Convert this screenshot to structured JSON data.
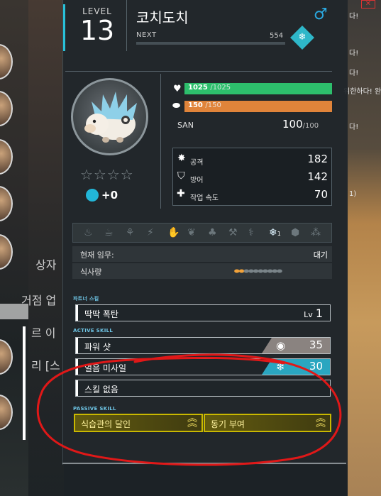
{
  "level": {
    "label": "LEVEL",
    "value": "13"
  },
  "pal": {
    "name": "코치도치",
    "gender_icon": "male-icon",
    "element_icon": "ice-element-icon"
  },
  "next": {
    "label": "NEXT",
    "value": "554",
    "progress_fraction": 0.0
  },
  "stars": {
    "filled": 0,
    "total": 4,
    "glyph": "☆☆☆☆"
  },
  "soul": {
    "value": "+0"
  },
  "hp": {
    "current": "1025",
    "max": "/1025",
    "color": "#2dbe6c"
  },
  "stamina": {
    "current": "150",
    "max": "/150",
    "color": "#e0843a"
  },
  "san": {
    "label": "SAN",
    "value": "100",
    "max": "/100"
  },
  "stats": [
    {
      "label": "공격",
      "value": "182",
      "icon": "attack-icon"
    },
    {
      "label": "방어",
      "value": "142",
      "icon": "shield-icon"
    },
    {
      "label": "작업 속도",
      "value": "70",
      "icon": "work-speed-icon"
    }
  ],
  "work_suitability": {
    "icons": [
      "kindling-icon",
      "watering-icon",
      "planting-icon",
      "electricity-icon",
      "handiwork-icon",
      "gathering-icon",
      "lumbering-icon",
      "mining-icon",
      "medicine-icon",
      "cooling-icon",
      "transporting-icon",
      "farming-icon"
    ],
    "active_level": "1"
  },
  "current_task": {
    "label": "현재 임무:",
    "value": "대기"
  },
  "food": {
    "label": "식사량",
    "filled": 2,
    "total": 10
  },
  "partner_skill": {
    "title": "파트너 스킬",
    "name": "딱딱 폭탄",
    "lv_label": "Lv",
    "lv": "1"
  },
  "active_skill": {
    "title": "ACTIVE SKILL",
    "skills": [
      {
        "name": "파워 샷",
        "cost": "35",
        "icon": "neutral-element-icon"
      },
      {
        "name": "얼음 미사일",
        "cost": "30",
        "icon": "ice-element-icon"
      },
      {
        "name": "스킬 없음"
      }
    ]
  },
  "passive_skill": {
    "title": "PASSIVE SKILL",
    "skills": [
      {
        "name": "식습관의 달인",
        "rank_icon": "rank-up-icon"
      },
      {
        "name": "동기 부여",
        "rank_icon": "rank-up-icon"
      }
    ]
  },
  "background": {
    "left_texts": [
      "상자",
      "거점 업",
      "르 이",
      "리 [스"
    ],
    "right_texts": [
      "다!",
      "다!",
      "다!",
      "위한하다! 완",
      "다!",
      "1)"
    ]
  }
}
